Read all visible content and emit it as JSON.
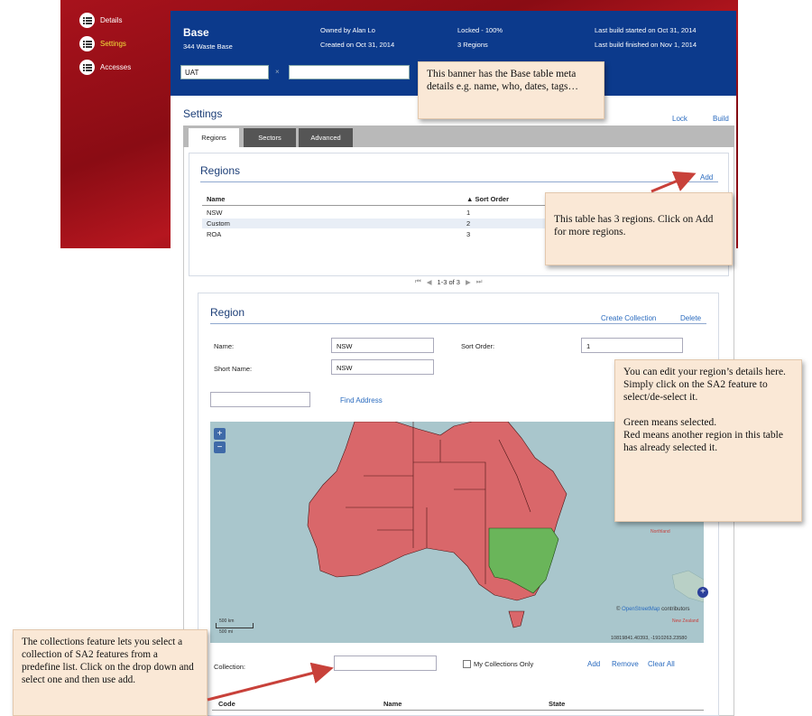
{
  "sidebar": {
    "items": [
      {
        "label": "Details"
      },
      {
        "label": "Settings"
      },
      {
        "label": "Accesses"
      }
    ]
  },
  "banner": {
    "name": "Base",
    "subtitle": "344 Waste Base",
    "owner": "Owned by Alan Lo",
    "created": "Created on Oct 31, 2014",
    "locked": "Locked - 100%",
    "regions_count": "3 Regions",
    "build_started": "Last build started on Oct 31, 2014",
    "build_finished": "Last build finished on Nov 1, 2014",
    "tag_value": "UAT",
    "tag_clear": "×"
  },
  "settings": {
    "title": "Settings",
    "lock_label": "Lock",
    "build_label": "Build",
    "tabs": [
      {
        "label": "Regions"
      },
      {
        "label": "Sectors"
      },
      {
        "label": "Advanced"
      }
    ]
  },
  "regions": {
    "title": "Regions",
    "add_label": "Add",
    "columns": {
      "name": "Name",
      "sort": "▲ Sort Order"
    },
    "rows": [
      {
        "name": "NSW",
        "sort": "1"
      },
      {
        "name": "Custom",
        "sort": "2"
      },
      {
        "name": "ROA",
        "sort": "3"
      }
    ],
    "pager_text": "1-3 of 3"
  },
  "region": {
    "title": "Region",
    "create_collection": "Create Collection",
    "delete_label": "Delete",
    "name_label": "Name:",
    "name_value": "NSW",
    "sort_label": "Sort Order:",
    "sort_value": "1",
    "short_label": "Short Name:",
    "short_value": "NSW",
    "find_address": "Find Address",
    "map": {
      "zoom_in": "+",
      "zoom_out": "−",
      "scale_km": "500 km",
      "scale_mi": "500 mi",
      "attribution_prefix": "©",
      "attribution_link": "OpenStreetMap",
      "attribution_suffix": "contributors",
      "coords": "10819841.40393, -1910263.23580",
      "label_northland": "Northland",
      "label_nz": "New Zealand",
      "colors": {
        "selected": "#6ab55a",
        "other": "#d9676a",
        "sea": "#a9c6cc"
      }
    },
    "collection_label": "Collection:",
    "my_collections": "My Collections Only",
    "add_label": "Add",
    "remove_label": "Remove",
    "clear_label": "Clear All",
    "columns": {
      "code": "Code",
      "name": "Name",
      "state": "State"
    }
  },
  "callouts": {
    "banner": "This banner has the Base table meta details e.g. name, who, dates, tags…",
    "table": "This table has 3 regions. Click on Add for more regions.",
    "edit": "You can edit your region’s details here. Simply click on the SA2 feature to select/de-select it.",
    "green": "Green means selected.",
    "red": "Red means another region in this table has already selected it.",
    "collections": "The collections feature lets you select a collection of SA2 features from a predefine list. Click on the drop down and select one and then use add."
  }
}
